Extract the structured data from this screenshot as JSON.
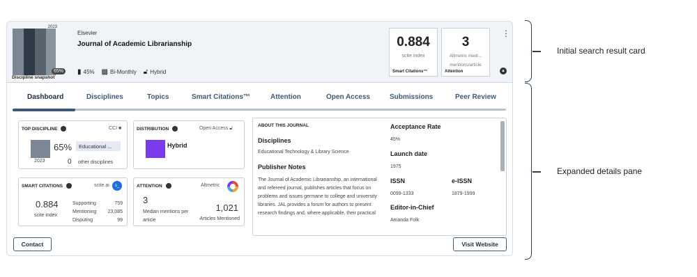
{
  "snapshot": {
    "year": "2023",
    "label": "Discipline snapshot",
    "percent": "65%",
    "colors": [
      "#7b8794",
      "#2e3a46",
      "#59636e",
      "#8a949d"
    ]
  },
  "journal": {
    "publisher": "Elsevier",
    "title": "Journal of Academic Librarianship",
    "oa_percent": "45%",
    "frequency": "Bi-Monthly",
    "access": "Hybrid"
  },
  "metrics": [
    {
      "value": "0.884",
      "sub": "scite index",
      "footer": "Smart Citations™"
    },
    {
      "value": "3",
      "sub": "Altmetric medi... mentions/article",
      "footer": "Attention"
    }
  ],
  "tabs": [
    "Dashboard",
    "Disciplines",
    "Topics",
    "Smart Citations™",
    "Attention",
    "Open Access",
    "Submissions",
    "Peer Review"
  ],
  "active_tab": "Dashboard",
  "top_discipline": {
    "header": "TOP DISCIPLINE",
    "right_label": "CCI",
    "percent": "65%",
    "name": "Educational ...",
    "year": "2023",
    "other_count": "0",
    "other_label": "other disciplines"
  },
  "distribution": {
    "header": "DISTRIBUTION",
    "right_label": "Open Access",
    "value": "Hybrid",
    "color": "#7c3aed"
  },
  "smart_citations": {
    "header": "SMART CITATIONS",
    "right_label": "scite.ai",
    "index": "0.884",
    "index_label": "scite index",
    "rows": [
      {
        "label": "Supporting",
        "value": "759"
      },
      {
        "label": "Mentioning",
        "value": "23,085"
      },
      {
        "label": "Disputing",
        "value": "99"
      }
    ]
  },
  "attention": {
    "header": "ATTENTION",
    "right_label": "Altmetric",
    "median": "3",
    "median_label": "Median mentions per article",
    "articles": "1,021",
    "articles_label": "Articles Mentioned"
  },
  "about": {
    "header": "ABOUT THIS JOURNAL",
    "disciplines_h": "Disciplines",
    "disciplines": "Educational Technology & Library Science",
    "notes_h": "Publisher Notes",
    "notes": "The Journal of Academic Librarianship, an international and refereed journal, publishes articles that focus on problems and issues germane to college and university libraries. JAL provides a forum for authors to present research findings and, where applicable, their practical",
    "acceptance_h": "Acceptance Rate",
    "acceptance": "45%",
    "launch_h": "Launch date",
    "launch": "1975",
    "issn_h": "ISSN",
    "issn": "0099-1333",
    "eissn_h": "e-ISSN",
    "eissn": "1879-1999",
    "editor_h": "Editor-in-Chief",
    "editor": "Amanda Folk"
  },
  "buttons": {
    "contact": "Contact",
    "visit": "Visit Website"
  },
  "annotations": {
    "top": "Initial search result card",
    "bottom": "Expanded details pane"
  }
}
